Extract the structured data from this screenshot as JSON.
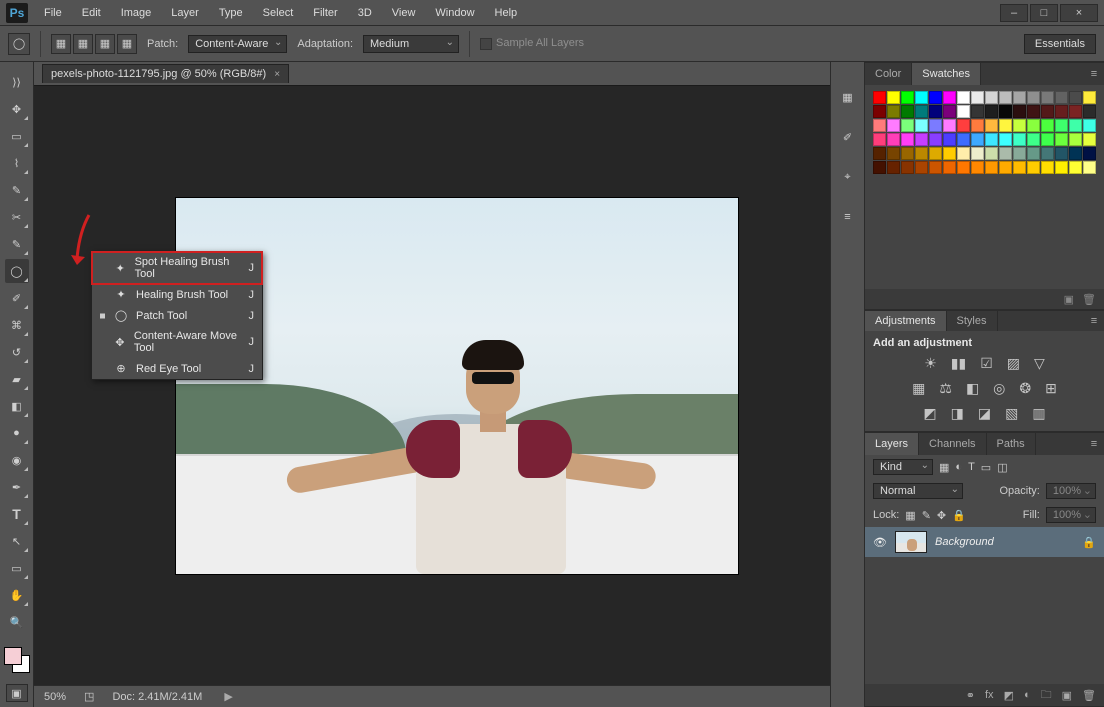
{
  "logo_text": "Ps",
  "menu": [
    "File",
    "Edit",
    "Image",
    "Layer",
    "Type",
    "Select",
    "Filter",
    "3D",
    "View",
    "Window",
    "Help"
  ],
  "window_controls": {
    "min": "–",
    "max": "□",
    "close": "×"
  },
  "options": {
    "patch_label": "Patch:",
    "patch_value": "Content-Aware",
    "adapt_label": "Adaptation:",
    "adapt_value": "Medium",
    "sample_all": "Sample All Layers",
    "essentials": "Essentials"
  },
  "document": {
    "tab_title": "pexels-photo-1121795.jpg @ 50% (RGB/8#)",
    "close_glyph": "×"
  },
  "flyout": {
    "items": [
      {
        "name": "Spot Healing Brush Tool",
        "shortcut": "J",
        "icon": "✦"
      },
      {
        "name": "Healing Brush Tool",
        "shortcut": "J",
        "icon": "✦"
      },
      {
        "name": "Patch Tool",
        "shortcut": "J",
        "icon": "◯",
        "current": true
      },
      {
        "name": "Content-Aware Move Tool",
        "shortcut": "J",
        "icon": "✥"
      },
      {
        "name": "Red Eye Tool",
        "shortcut": "J",
        "icon": "⊕"
      }
    ],
    "highlight_index": 0
  },
  "status": {
    "zoom": "50%",
    "doc": "Doc: 2.41M/2.41M"
  },
  "panels": {
    "color_tab": "Color",
    "swatches_tab": "Swatches",
    "adjustments_tab": "Adjustments",
    "styles_tab": "Styles",
    "add_adjust": "Add an adjustment",
    "layers_tab": "Layers",
    "channels_tab": "Channels",
    "paths_tab": "Paths",
    "kind_label": "Kind",
    "blend_mode": "Normal",
    "opacity_label": "Opacity:",
    "opacity_value": "100%",
    "lock_label": "Lock:",
    "fill_label": "Fill:",
    "fill_value": "100%",
    "bg_layer": "Background"
  },
  "swatch_colors": [
    "#ff0000",
    "#ffff00",
    "#00ff00",
    "#00ffff",
    "#0000ff",
    "#ff00ff",
    "#ffffff",
    "#eaeaea",
    "#d4d4d4",
    "#bdbdbd",
    "#a6a6a6",
    "#8f8f8f",
    "#797979",
    "#626262",
    "#4b4b4b",
    "#ffeb3b",
    "#7b0000",
    "#7b7b00",
    "#007b00",
    "#007b7b",
    "#00007b",
    "#7b007b",
    "#ffffff",
    "#353535",
    "#1e1e1e",
    "#080808",
    "#2b0f0f",
    "#3f1414",
    "#531919",
    "#671e1e",
    "#7b2323",
    "#2b2b2b",
    "#ff7b7b",
    "#ff7bff",
    "#7bff7b",
    "#7bffff",
    "#7b7bff",
    "#ff7bff",
    "#ff3e3e",
    "#ff7b3e",
    "#ffb83e",
    "#fff53e",
    "#c6ff3e",
    "#89ff3e",
    "#4cff3e",
    "#3eff6c",
    "#3effa9",
    "#3effe6",
    "#ff3e7b",
    "#ff3eb8",
    "#ff3ef5",
    "#c63eff",
    "#893eff",
    "#4c3eff",
    "#3e6cff",
    "#3ea9ff",
    "#3ee6ff",
    "#3effff",
    "#3effc6",
    "#3eff89",
    "#3eff4c",
    "#6cff3e",
    "#a9ff3e",
    "#e6ff3e",
    "#552200",
    "#774400",
    "#996600",
    "#bb8800",
    "#ddaa00",
    "#ffcc00",
    "#ffeeaa",
    "#eeeecc",
    "#ccddaa",
    "#aabbaa",
    "#88aa99",
    "#669988",
    "#447777",
    "#225566",
    "#003355",
    "#001144",
    "#441100",
    "#662200",
    "#883300",
    "#aa4400",
    "#cc5500",
    "#ee6600",
    "#ff7700",
    "#ff8800",
    "#ff9900",
    "#ffaa00",
    "#ffbb00",
    "#ffcc00",
    "#ffdd00",
    "#ffee00",
    "#ffff33",
    "#ffff88"
  ],
  "tools": [
    "move",
    "marquee",
    "lasso",
    "quick-select",
    "crop",
    "eyedropper",
    "spacer",
    "brush",
    "clone",
    "history-brush",
    "eraser",
    "gradient",
    "blur",
    "dodge",
    "pen",
    "type",
    "path-select",
    "rectangle",
    "hand",
    "zoom"
  ],
  "dock_icons": [
    "swatch-picker",
    "brush-presets",
    "brush-settings",
    "paragraph"
  ]
}
